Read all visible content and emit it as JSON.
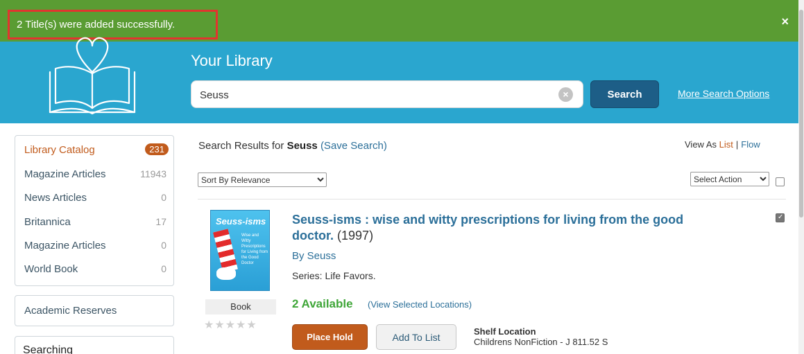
{
  "notification": {
    "message": "2 Title(s) were added successfully.",
    "close_glyph": "×",
    "bar_color": "#5a9c33",
    "highlight_color": "#e2342f"
  },
  "header": {
    "logo_icon": "heart-book-icon",
    "title": "Your Library",
    "search_value": "Seuss",
    "clear_glyph": "×",
    "search_button": "Search",
    "more_options": "More Search Options",
    "bg_color": "#2aa6cf"
  },
  "sidebar": {
    "facets": [
      {
        "label": "Library Catalog",
        "count": "231"
      },
      {
        "label": "Magazine Articles",
        "count": "11943"
      },
      {
        "label": "News Articles",
        "count": "0"
      },
      {
        "label": "Britannica",
        "count": "17"
      },
      {
        "label": "Magazine Articles",
        "count": "0"
      },
      {
        "label": "World Book",
        "count": "0"
      }
    ],
    "reserves": "Academic Reserves",
    "searching": "Searching"
  },
  "results": {
    "prefix": "Search Results for",
    "term": "Seuss",
    "save_search": "(Save Search)",
    "view_as": "View As",
    "view_list": "List",
    "view_sep": "|",
    "view_flow": "Flow",
    "sort_selected": "Sort By Relevance",
    "action_selected": "Select Action"
  },
  "item": {
    "cover_title": "Seuss-isms",
    "cover_small_text": "Wise and Witty Prescriptions for Living from the Good Doctor",
    "format": "Book",
    "stars": "★★★★★",
    "rating": 0,
    "title": "Seuss-isms : wise and witty prescriptions for living from the good doctor.",
    "year": "(1997)",
    "author": "By Seuss",
    "series": "Series: Life Favors.",
    "available": "2 Available",
    "view_locations": "(View Selected Locations)",
    "place_hold": "Place Hold",
    "add_to_list": "Add To List",
    "shelf_label": "Shelf Location",
    "shelf_value": "Childrens NonFiction - J 811.52 S",
    "selected": true
  }
}
